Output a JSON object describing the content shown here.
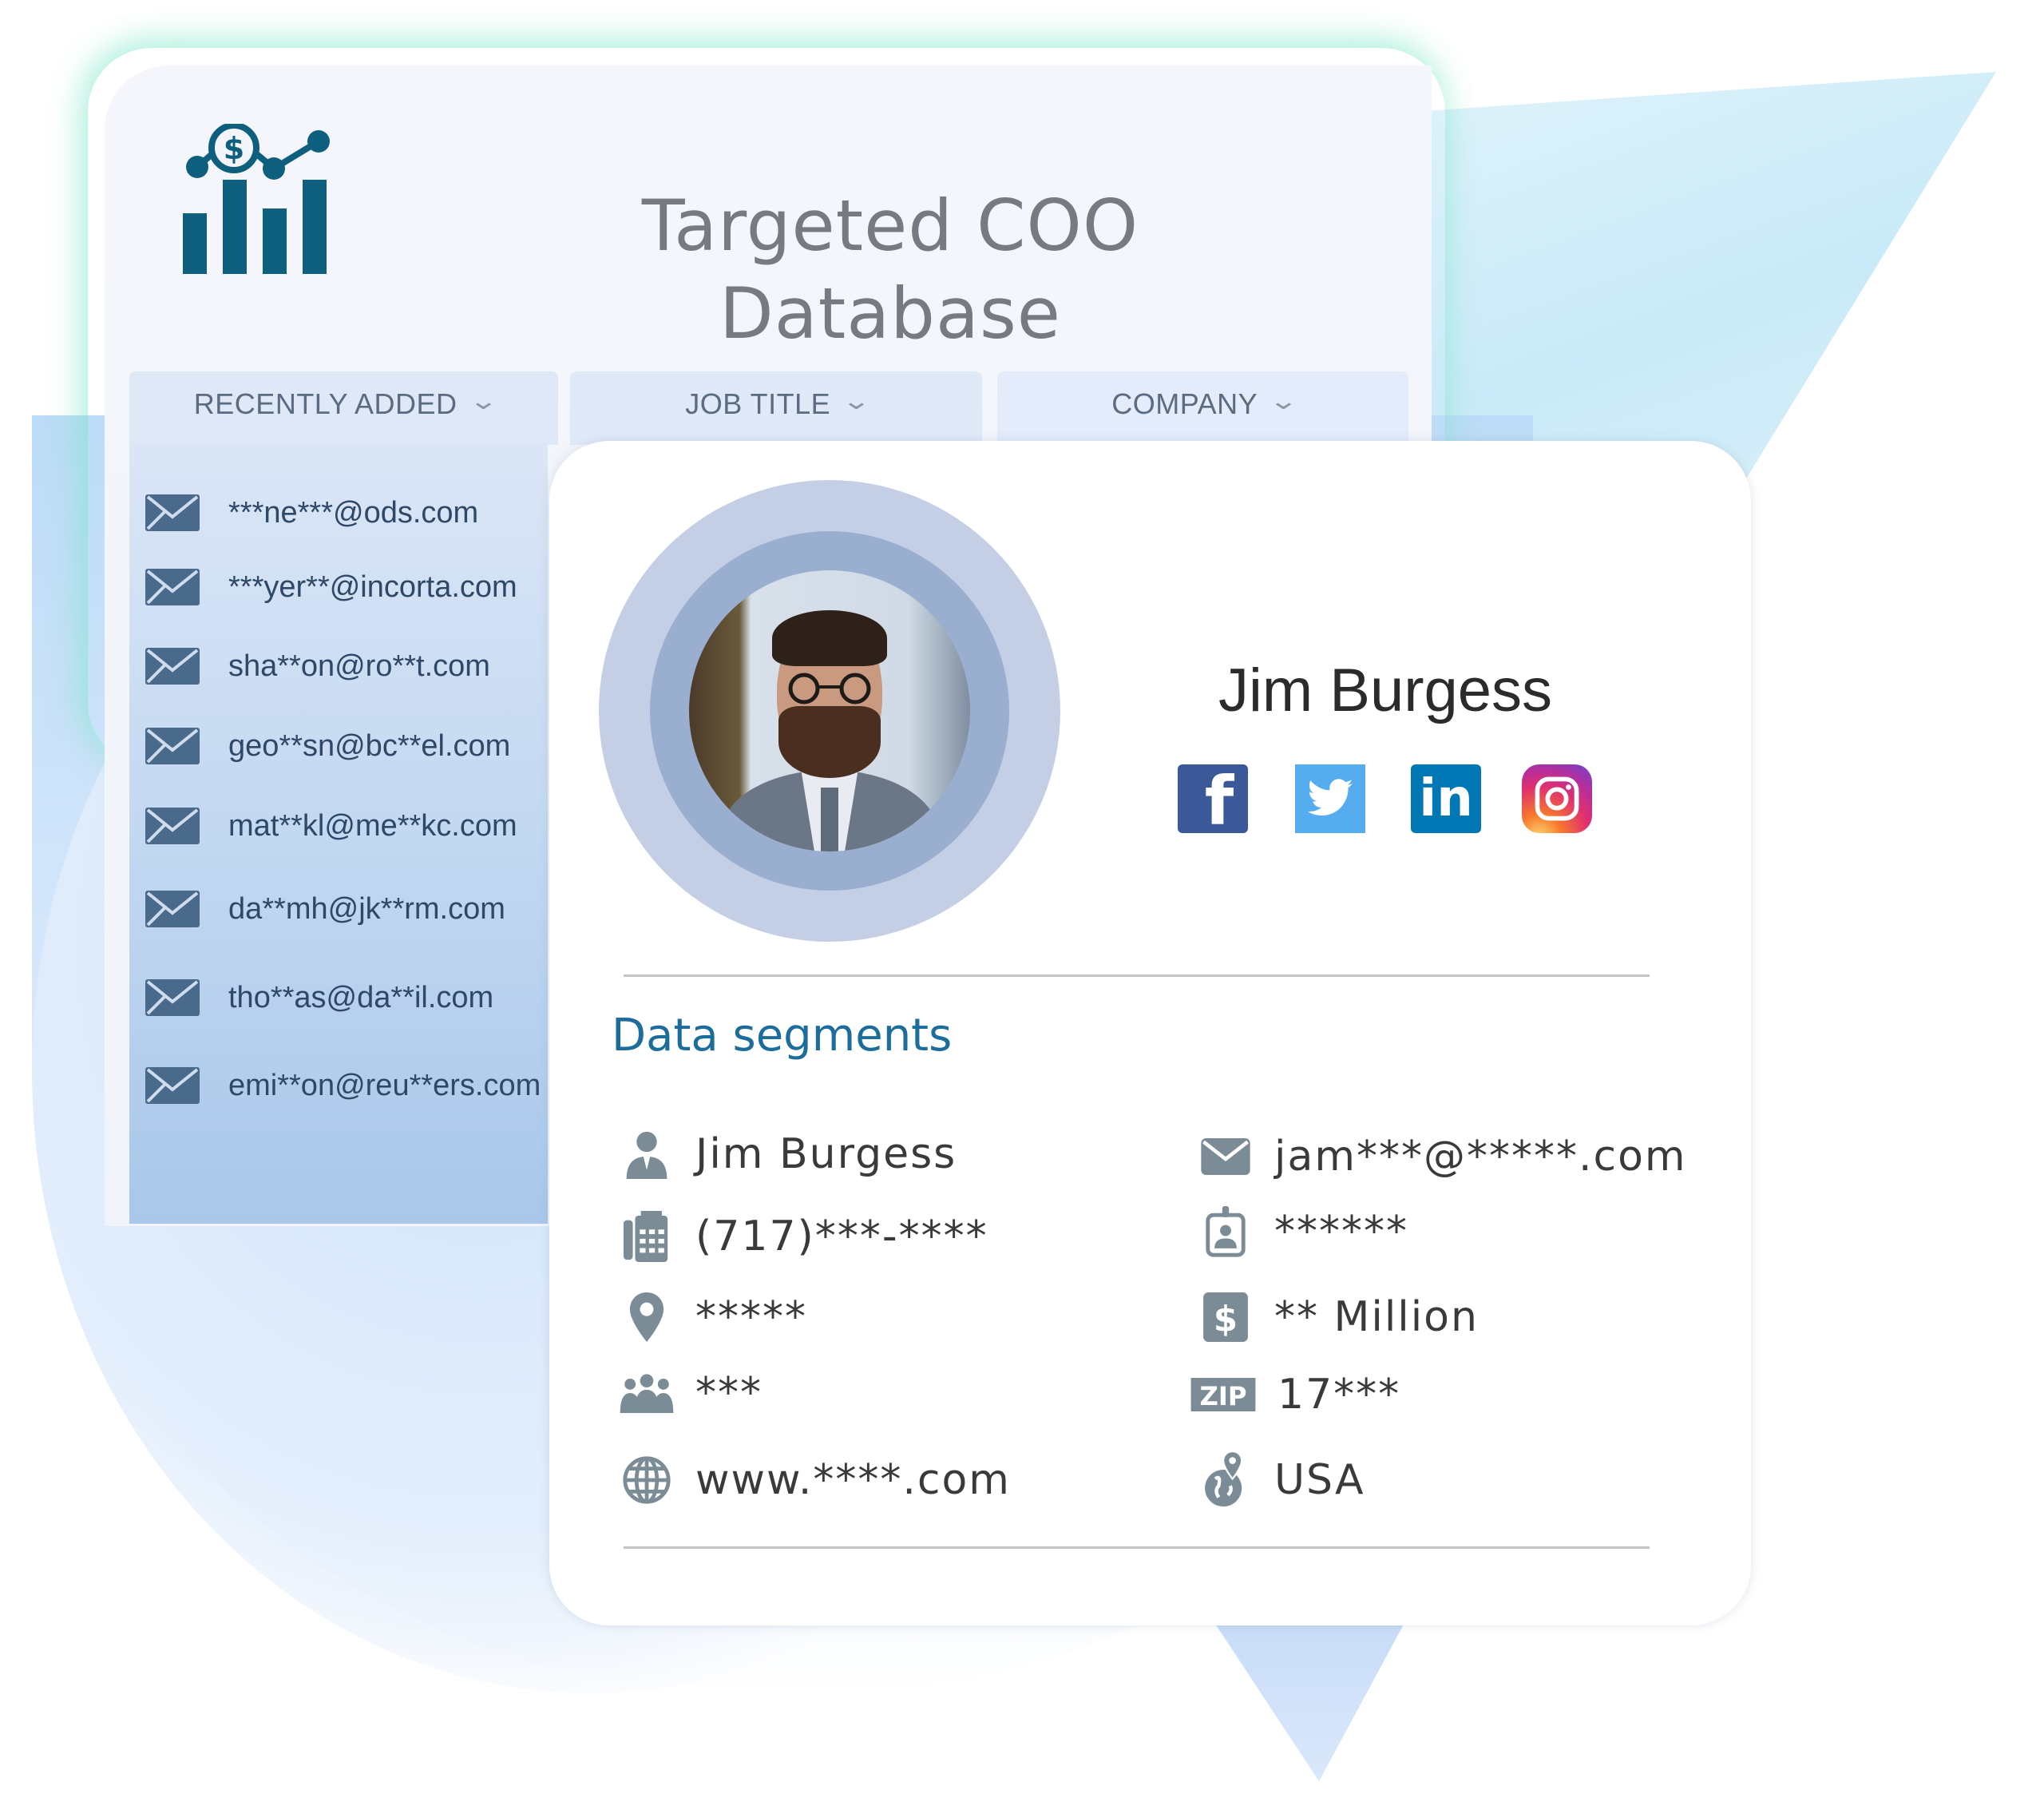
{
  "header": {
    "title": "Targeted COO Database",
    "logo_icon": "chart-dollar-icon"
  },
  "columns": [
    {
      "label": "RECENTLY ADDED",
      "icon": "chevron-down-icon"
    },
    {
      "label": "JOB TITLE",
      "icon": "chevron-down-icon"
    },
    {
      "label": "COMPANY",
      "icon": "chevron-down-icon"
    }
  ],
  "emails": [
    "***ne***@ods.com",
    "***yer**@incorta.com",
    "sha**on@ro**t.com",
    "geo**sn@bc**el.com",
    "mat**kl@me**kc.com",
    "da**mh@jk**rm.com",
    "tho**as@da**il.com",
    "emi**on@reu**ers.com"
  ],
  "profile": {
    "name": "Jim Burgess",
    "social": [
      {
        "name": "facebook",
        "glyph": "f",
        "color": "#3b5998"
      },
      {
        "name": "twitter",
        "glyph": "",
        "color": "#55acee"
      },
      {
        "name": "linkedin",
        "glyph": "in",
        "color": "#0077b5"
      },
      {
        "name": "instagram",
        "glyph": "",
        "color": "#e0316e"
      }
    ]
  },
  "segments": {
    "title": "Data segments",
    "left": [
      {
        "icon": "person-icon",
        "value": "Jim Burgess"
      },
      {
        "icon": "phone-fax-icon",
        "value": "(717)***-****"
      },
      {
        "icon": "location-pin-icon",
        "value": "*****"
      },
      {
        "icon": "team-icon",
        "value": "***"
      },
      {
        "icon": "globe-icon",
        "value": "www.****.com"
      }
    ],
    "right": [
      {
        "icon": "envelope-icon",
        "value": "jam***@*****.com"
      },
      {
        "icon": "id-badge-icon",
        "value": "******"
      },
      {
        "icon": "dollar-icon",
        "value": "** Million"
      },
      {
        "icon": "zip-icon",
        "value": "17***"
      },
      {
        "icon": "world-pin-icon",
        "value": "USA"
      }
    ]
  },
  "colors": {
    "accent": "#1c6d9c",
    "logo": "#0e5f7d",
    "icon_gray": "#7b8c96",
    "envelope": "#4a6a8c"
  }
}
